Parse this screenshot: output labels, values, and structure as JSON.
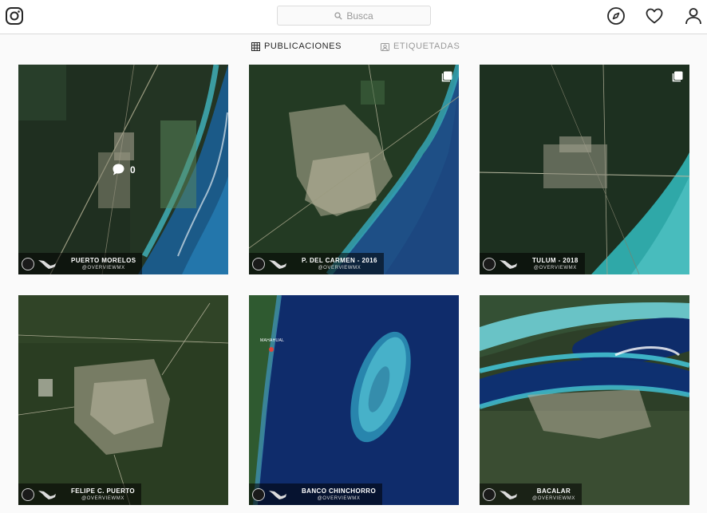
{
  "header": {
    "search_placeholder": "Busca",
    "icons": [
      "instagram-logo",
      "explore-compass",
      "activity-heart",
      "profile-person"
    ]
  },
  "tabs": [
    {
      "label": "PUBLICACIONES",
      "icon": "grid-icon",
      "active": true
    },
    {
      "label": "ETIQUETADAS",
      "icon": "tag-icon",
      "active": false
    }
  ],
  "posts": [
    {
      "caption": "PUERTO MORELOS",
      "handle": "@OVERVIEWMX",
      "comments": "0",
      "multi": false
    },
    {
      "caption": "P. DEL CARMEN - 2016",
      "handle": "@OVERVIEWMX",
      "multi": true
    },
    {
      "caption": "TULUM - 2018",
      "handle": "@OVERVIEWMX",
      "multi": true
    },
    {
      "caption": "FELIPE C. PUERTO",
      "handle": "@OVERVIEWMX",
      "multi": false
    },
    {
      "caption": "BANCO CHINCHORRO",
      "handle": "@OVERVIEWMX",
      "place_label": "MAHAHUAL",
      "multi": false
    },
    {
      "caption": "BACALAR",
      "handle": "@OVERVIEWMX",
      "multi": false
    }
  ],
  "colors": {
    "border": "#dbdbdb",
    "text": "#262626",
    "muted": "#999999"
  }
}
